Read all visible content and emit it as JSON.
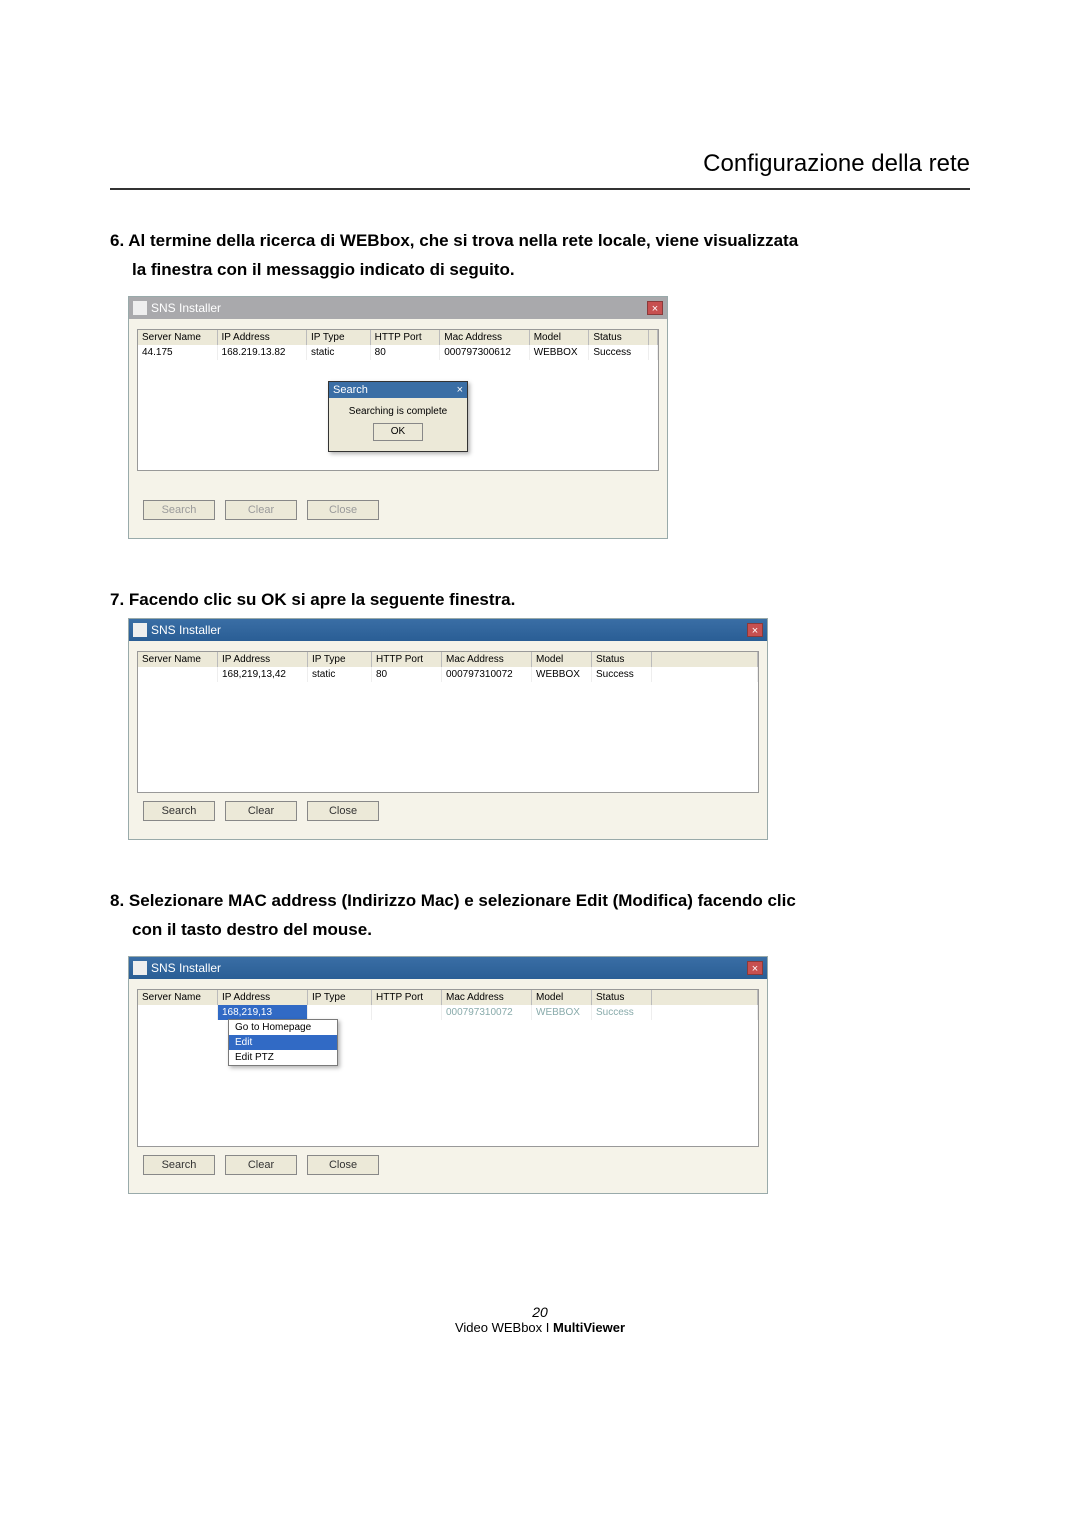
{
  "header": {
    "page_title": "Configurazione della rete"
  },
  "steps": {
    "s6_line1": "6. Al termine della ricerca di WEBbox, che si trova nella rete locale, viene visualizzata",
    "s6_line2": "la finestra con il messaggio indicato di seguito.",
    "s7": "7. Facendo clic su OK si apre la seguente finestra.",
    "s8_line1": "8. Selezionare MAC address (Indirizzo Mac) e selezionare Edit (Modifica) facendo clic",
    "s8_line2": "con il tasto destro del mouse."
  },
  "win": {
    "title": "SNS Installer",
    "close_glyph": "×"
  },
  "table_headers": {
    "server_name": "Server Name",
    "ip_address": "IP Address",
    "ip_type": "IP Type",
    "http_port": "HTTP Port",
    "mac_address": "Mac Address",
    "model": "Model",
    "status": "Status"
  },
  "shot1": {
    "row": {
      "server_name": "44.175",
      "ip_address": "168.219.13.82",
      "ip_type": "static",
      "http_port": "80",
      "mac_address": "000797300612",
      "model": "WEBBOX",
      "status": "Success"
    },
    "modal": {
      "title": "Search",
      "text": "Searching is complete",
      "ok": "OK"
    },
    "buttons": {
      "search": "Search",
      "clear": "Clear",
      "close": "Close"
    }
  },
  "shot2": {
    "row": {
      "server_name": "",
      "ip_address": "168,219,13,42",
      "ip_type": "static",
      "http_port": "80",
      "mac_address": "000797310072",
      "model": "WEBBOX",
      "status": "Success"
    },
    "buttons": {
      "search": "Search",
      "clear": "Clear",
      "close": "Close"
    }
  },
  "shot3": {
    "row": {
      "server_name": "",
      "ip_address": "168,219,13",
      "ip_type": "",
      "http_port": "",
      "mac_address": "000797310072",
      "model": "WEBBOX",
      "status": "Success"
    },
    "context_menu": {
      "go_homepage": "Go to Homepage",
      "edit": "Edit",
      "edit_ptz": "Edit PTZ"
    },
    "buttons": {
      "search": "Search",
      "clear": "Clear",
      "close": "Close"
    }
  },
  "footer": {
    "page_number": "20",
    "line_prefix": "Video WEBbox I ",
    "line_bold": "MultiViewer"
  }
}
